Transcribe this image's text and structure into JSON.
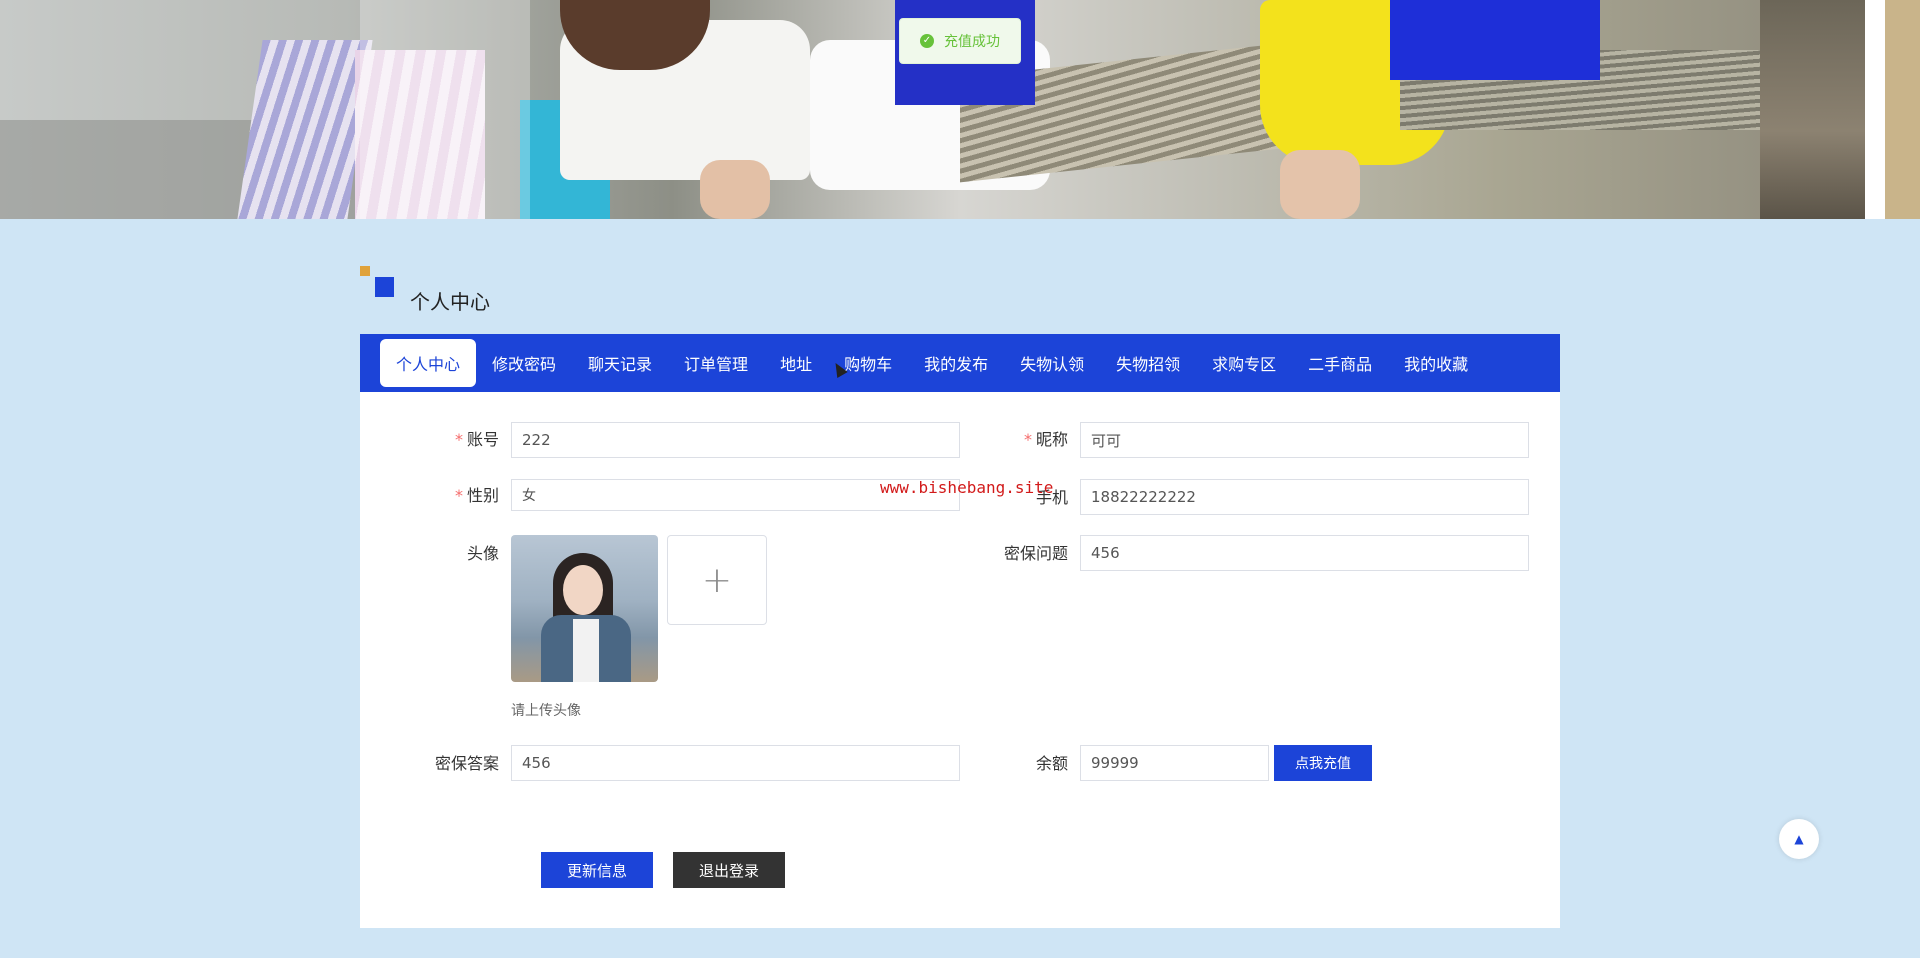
{
  "toast": {
    "message": "充值成功",
    "icon": "success-check-icon"
  },
  "section": {
    "title": "个人中心"
  },
  "tabs": [
    {
      "label": "个人中心",
      "active": true
    },
    {
      "label": "修改密码"
    },
    {
      "label": "聊天记录"
    },
    {
      "label": "订单管理"
    },
    {
      "label": "地址"
    },
    {
      "label": "购物车"
    },
    {
      "label": "我的发布"
    },
    {
      "label": "失物认领"
    },
    {
      "label": "失物招领"
    },
    {
      "label": "求购专区"
    },
    {
      "label": "二手商品"
    },
    {
      "label": "我的收藏"
    }
  ],
  "form": {
    "account": {
      "label": "账号",
      "required_mark": "*",
      "value": "222"
    },
    "nickname": {
      "label": "昵称",
      "required_mark": "*",
      "value": "可可"
    },
    "gender": {
      "label": "性别",
      "required_mark": "*",
      "value": "女"
    },
    "phone": {
      "label": "手机",
      "value": "18822222222"
    },
    "avatar": {
      "label": "头像",
      "upload_symbol": "+",
      "hint": "请上传头像"
    },
    "security_question": {
      "label": "密保问题",
      "value": "456"
    },
    "security_answer": {
      "label": "密保答案",
      "value": "456"
    },
    "balance": {
      "label": "余额",
      "value": "99999",
      "recharge_button": "点我充值"
    }
  },
  "actions": {
    "update": "更新信息",
    "logout": "退出登录"
  },
  "watermark": "www.bishebang.site",
  "back_to_top": "▲",
  "colors": {
    "primary": "#1c44d8",
    "accent": "#e0a23a",
    "page_bg": "#cfe5f5",
    "success": "#67c23a",
    "required": "#f56c6c"
  }
}
